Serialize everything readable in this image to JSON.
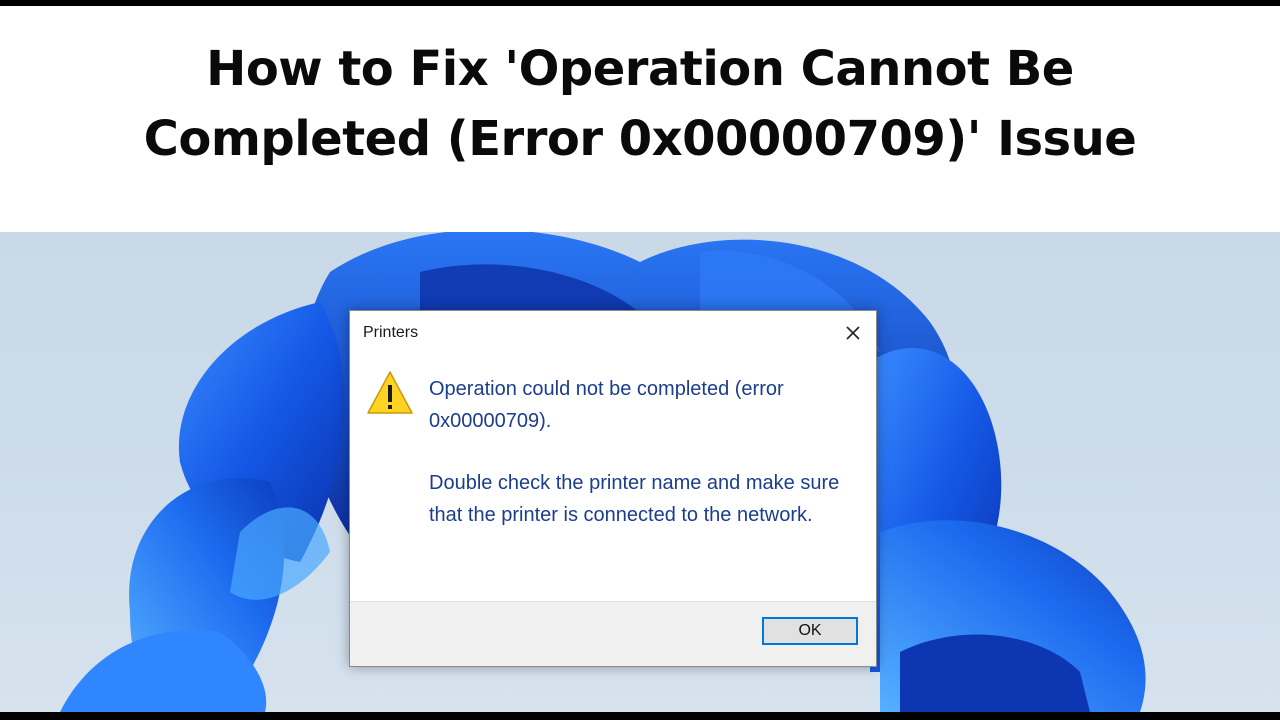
{
  "headline": {
    "line1": "How to Fix 'Operation Cannot Be",
    "line2": "Completed (Error 0x00000709)' Issue"
  },
  "dialog": {
    "title": "Printers",
    "icon": "warning-icon",
    "message_primary": "Operation could not be completed (error 0x00000709).",
    "message_secondary": "Double check the printer name and make sure that the printer is connected to the network.",
    "ok_label": "OK",
    "close_icon": "close-icon"
  },
  "colors": {
    "message_text": "#1b3d8f",
    "ok_focus_border": "#0078d7",
    "wallpaper_blue": "#1a5fe0",
    "warning_yellow": "#ffd324"
  }
}
